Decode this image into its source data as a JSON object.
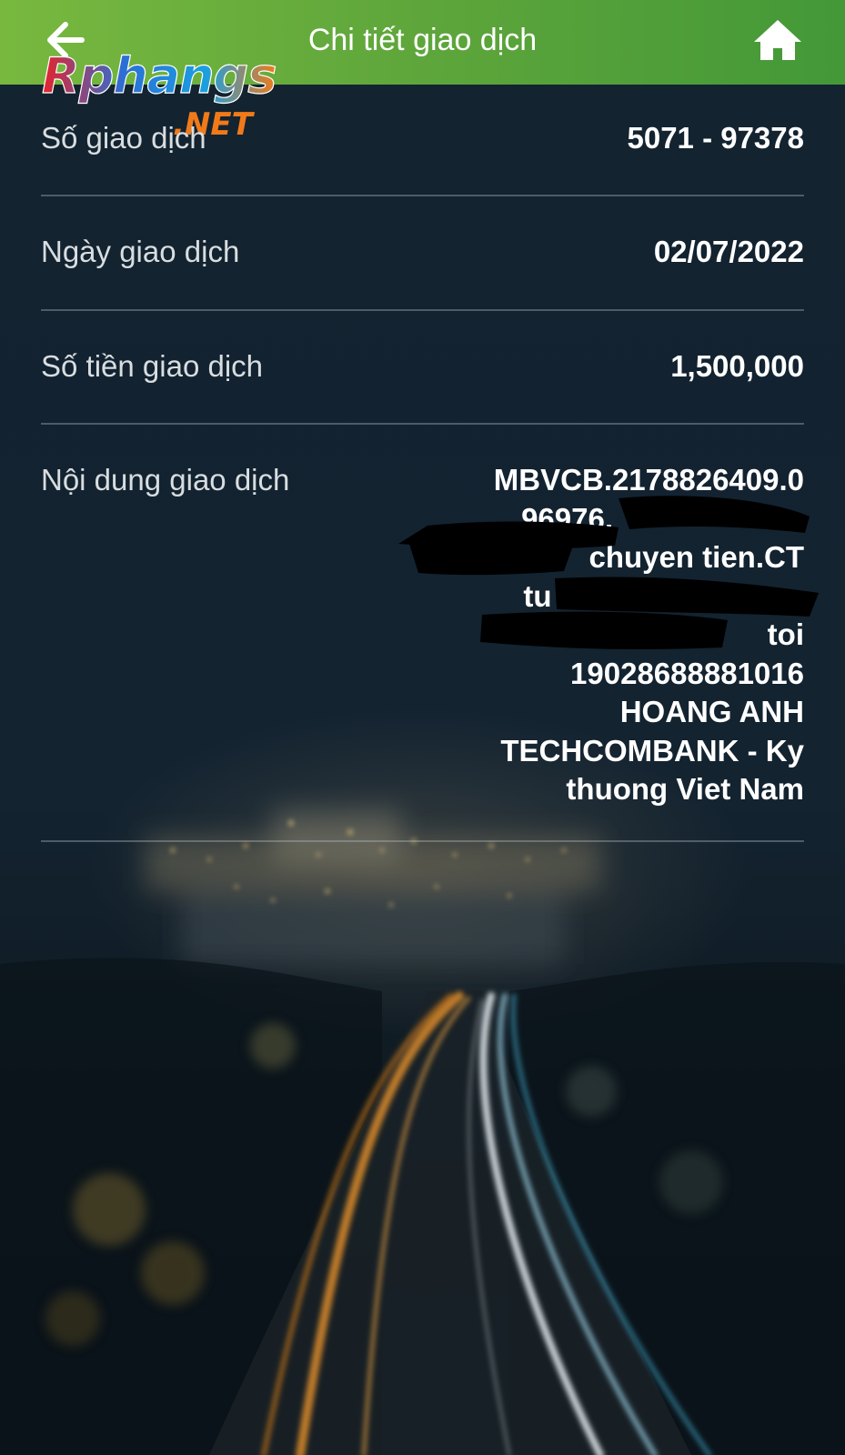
{
  "header": {
    "title": "Chi tiết giao dịch",
    "back_icon": "arrow-left-icon",
    "home_icon": "home-icon",
    "background_color": "#5ea63b"
  },
  "watermark": {
    "text_main": "Rphangs",
    "text_sub": ".NET"
  },
  "details": {
    "transaction_number": {
      "label": "Số giao dịch",
      "value": "5071 - 97378"
    },
    "transaction_date": {
      "label": "Ngày giao dịch",
      "value": "02/07/2022"
    },
    "amount": {
      "label": "Số tiền giao dịch",
      "value": "1,500,000"
    },
    "content": {
      "label": "Nội dung giao dịch",
      "lines": [
        "MBVCB.2178826409.0",
        "96976.",
        "chuyen tien.CT",
        "tu 9",
        "toi",
        "19028688881016",
        "HOANG ANH",
        "TECHCOMBANK - Ky",
        "thuong Viet Nam"
      ]
    }
  }
}
